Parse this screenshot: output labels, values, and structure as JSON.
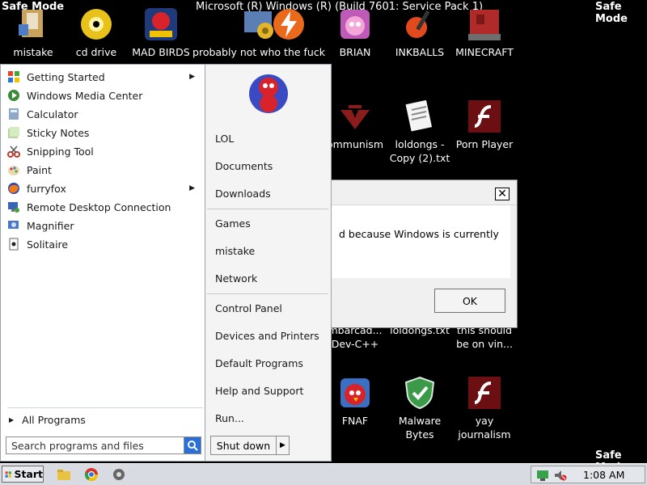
{
  "watermarks": {
    "top_left": "Safe Mode",
    "top_right": "Safe Mode",
    "top_center": "Microsoft (R) Windows (R) (Build 7601: Service Pack 1)",
    "bottom_right": "Safe Mode"
  },
  "desktop_icons": [
    {
      "label": "mistake",
      "icon": "computer-icon"
    },
    {
      "label": "cd drive",
      "icon": "cd-icon"
    },
    {
      "label": "MAD BIRDS",
      "icon": "angry-birds-space-icon"
    },
    {
      "label": "probably not who the fuck",
      "icon": "settings-icon"
    },
    {
      "label": "",
      "icon": "lightning-icon"
    },
    {
      "label": "BRIAN",
      "icon": "angry-birds-icon"
    },
    {
      "label": "INKBALLS",
      "icon": "inkball-icon"
    },
    {
      "label": "MINECRAFT",
      "icon": "minecraft-icon"
    },
    {
      "label": "ommunism",
      "icon": "papers-please-icon"
    },
    {
      "label": "loldongs - Copy (2).txt",
      "icon": "text-file-icon"
    },
    {
      "label": "Porn Player",
      "icon": "flash-icon"
    },
    {
      "label": "mbarcad... Dev-C++",
      "icon": "devcpp-icon"
    },
    {
      "label": "loldongs.txt",
      "icon": "text-file-icon"
    },
    {
      "label": "this should be on vin...",
      "icon": "file-icon"
    },
    {
      "label": "FNAF",
      "icon": "angry-bird-icon"
    },
    {
      "label": "Malware Bytes",
      "icon": "shield-check-icon"
    },
    {
      "label": "yay journalism",
      "icon": "flash-icon"
    }
  ],
  "dialog": {
    "message": "d because Windows is currently",
    "ok_label": "OK",
    "close_glyph": "✕"
  },
  "start_menu": {
    "programs": [
      {
        "label": "Getting Started",
        "icon": "getting-started-icon",
        "has_submenu": true
      },
      {
        "label": "Windows Media Center",
        "icon": "media-center-icon",
        "has_submenu": false
      },
      {
        "label": "Calculator",
        "icon": "calculator-icon",
        "has_submenu": false
      },
      {
        "label": "Sticky Notes",
        "icon": "sticky-notes-icon",
        "has_submenu": false
      },
      {
        "label": "Snipping Tool",
        "icon": "snipping-tool-icon",
        "has_submenu": false
      },
      {
        "label": "Paint",
        "icon": "paint-icon",
        "has_submenu": false
      },
      {
        "label": "furryfox",
        "icon": "firefox-icon",
        "has_submenu": true
      },
      {
        "label": "Remote Desktop Connection",
        "icon": "remote-desktop-icon",
        "has_submenu": false
      },
      {
        "label": "Magnifier",
        "icon": "magnifier-icon",
        "has_submenu": false
      },
      {
        "label": "Solitaire",
        "icon": "solitaire-icon",
        "has_submenu": false
      }
    ],
    "all_programs_label": "All Programs",
    "search_placeholder": "Search programs and files",
    "right_items": {
      "lol": "LOL",
      "documents": "Documents",
      "downloads": "Downloads",
      "games": "Games",
      "mistake": "mistake",
      "network": "Network",
      "control_panel": "Control Panel",
      "devices": "Devices and Printers",
      "default_programs": "Default Programs",
      "help": "Help and Support",
      "run": "Run..."
    },
    "shutdown_label": "Shut down"
  },
  "taskbar": {
    "start_label": "Start",
    "clock": "1:08 AM"
  },
  "colors": {
    "desktop": "#000000",
    "menu_left": "#ffffff",
    "menu_right": "#f4f4f4",
    "taskbar": "#d8dce2",
    "accent_blue": "#2a6fd6"
  }
}
